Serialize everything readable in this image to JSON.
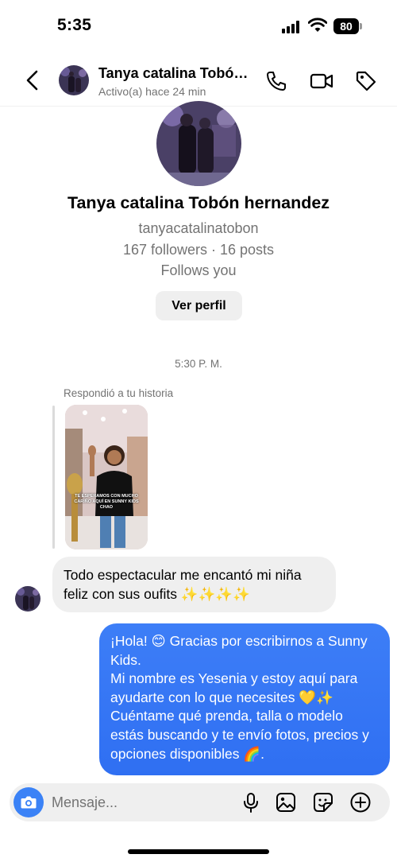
{
  "status_bar": {
    "time": "5:35",
    "battery": "80"
  },
  "header": {
    "name": "Tanya catalina Tobó…",
    "activity": "Activo(a) hace 24 min",
    "icons": [
      "back-chevron-icon",
      "phone-icon",
      "video-camera-icon",
      "tag-icon"
    ]
  },
  "profile": {
    "full_name": "Tanya catalina Tobón hernandez",
    "username": "tanyacatalinatobon",
    "stats": "167 followers · 16 posts",
    "follows": "Follows you",
    "view_button": "Ver perfil"
  },
  "thread": {
    "timestamp": "5:30 P. M.",
    "story_reply_label": "Respondió a tu historia",
    "story_caption": "TE ESPERAMOS CON MUCHO CARIÑO AQUÍ EN SUNNY KIDS CHAO",
    "incoming_message": "Todo espectacular me encantó mi niña feliz con sus oufits ✨✨✨✨",
    "outgoing_message": "¡Hola! 😊 Gracias por escribirnos a Sunny Kids.\nMi nombre es Yesenia y estoy aquí para ayudarte con lo que necesites 💛✨\nCuéntame qué prenda, talla o modelo estás buscando y te envío fotos, precios y opciones disponibles 🌈."
  },
  "composer": {
    "placeholder": "Mensaje...",
    "icons": [
      "camera-icon",
      "microphone-icon",
      "gallery-icon",
      "sticker-icon",
      "plus-circle-icon"
    ]
  },
  "colors": {
    "accent": "#3b82f6",
    "bubble_in": "#efefef",
    "secondary_text": "#737373"
  }
}
